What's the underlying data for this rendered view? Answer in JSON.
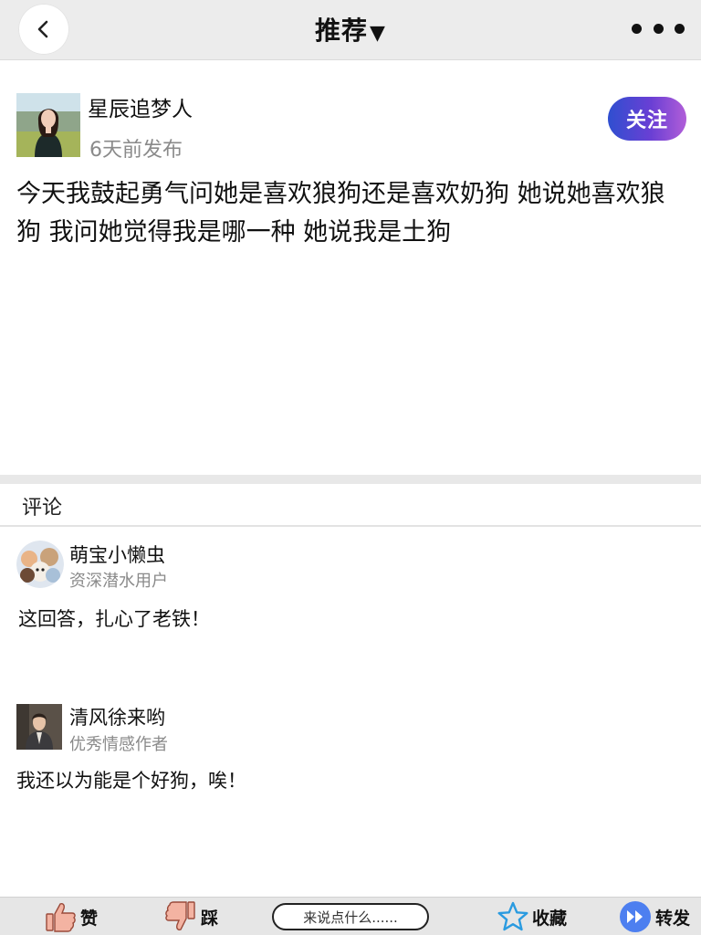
{
  "header": {
    "title": "推荐",
    "caret": "▼"
  },
  "post": {
    "author_name": "星辰追梦人",
    "time": "6天前发布",
    "follow_label": "关注",
    "text": "今天我鼓起勇气问她是喜欢狼狗还是喜欢奶狗 她说她喜欢狼狗 我问她觉得我是哪一种 她说我是土狗"
  },
  "comments": {
    "title": "评论",
    "items": [
      {
        "name": "萌宝小懒虫",
        "badge": "资深潜水用户",
        "text": "这回答，扎心了老铁！"
      },
      {
        "name": "清风徐来哟",
        "badge": "优秀情感作者",
        "text": "我还以为能是个好狗，唉！"
      }
    ]
  },
  "bottom_bar": {
    "like_label": "赞",
    "dislike_label": "踩",
    "input_placeholder": "来说点什么......",
    "favorite_label": "收藏",
    "share_label": "转发"
  },
  "colors": {
    "header_bg": "#ececec",
    "follow_gradient_start": "#2f4fd0",
    "follow_gradient_end": "#b15ed8",
    "muted_text": "#8a8a8a",
    "star_blue": "#2a9be0",
    "share_blue": "#4d7ff0",
    "thumb_skin": "#f3b3a2"
  },
  "icons": {
    "back": "chevron-left-icon",
    "more": "more-dots-icon",
    "like": "thumbs-up-icon",
    "dislike": "thumbs-down-icon",
    "favorite": "star-icon",
    "share": "forward-icon"
  }
}
